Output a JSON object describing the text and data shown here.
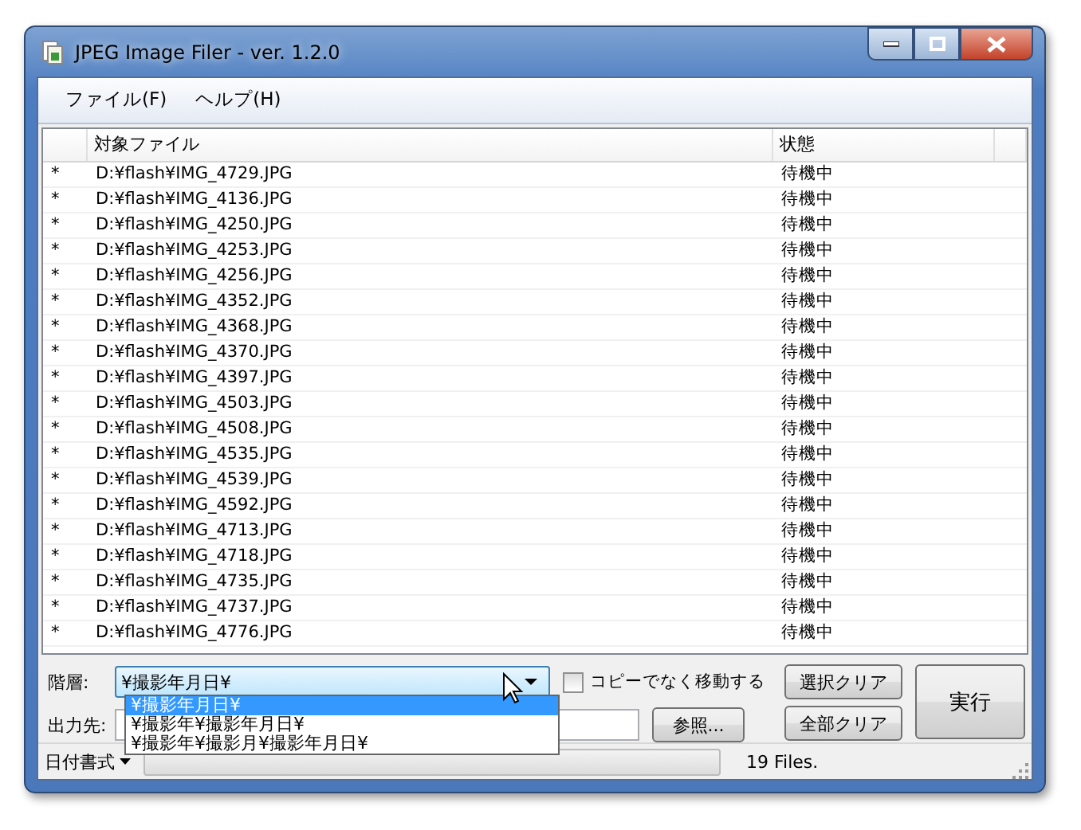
{
  "window": {
    "title": "JPEG Image Filer - ver. 1.2.0"
  },
  "menu": [
    "ファイル(F)",
    "ヘルプ(H)"
  ],
  "table": {
    "columns": [
      "対象ファイル",
      "状態"
    ],
    "rows": [
      {
        "mark": "*",
        "file": "D:¥flash¥IMG_4729.JPG",
        "status": "待機中"
      },
      {
        "mark": "*",
        "file": "D:¥flash¥IMG_4136.JPG",
        "status": "待機中"
      },
      {
        "mark": "*",
        "file": "D:¥flash¥IMG_4250.JPG",
        "status": "待機中"
      },
      {
        "mark": "*",
        "file": "D:¥flash¥IMG_4253.JPG",
        "status": "待機中"
      },
      {
        "mark": "*",
        "file": "D:¥flash¥IMG_4256.JPG",
        "status": "待機中"
      },
      {
        "mark": "*",
        "file": "D:¥flash¥IMG_4352.JPG",
        "status": "待機中"
      },
      {
        "mark": "*",
        "file": "D:¥flash¥IMG_4368.JPG",
        "status": "待機中"
      },
      {
        "mark": "*",
        "file": "D:¥flash¥IMG_4370.JPG",
        "status": "待機中"
      },
      {
        "mark": "*",
        "file": "D:¥flash¥IMG_4397.JPG",
        "status": "待機中"
      },
      {
        "mark": "*",
        "file": "D:¥flash¥IMG_4503.JPG",
        "status": "待機中"
      },
      {
        "mark": "*",
        "file": "D:¥flash¥IMG_4508.JPG",
        "status": "待機中"
      },
      {
        "mark": "*",
        "file": "D:¥flash¥IMG_4535.JPG",
        "status": "待機中"
      },
      {
        "mark": "*",
        "file": "D:¥flash¥IMG_4539.JPG",
        "status": "待機中"
      },
      {
        "mark": "*",
        "file": "D:¥flash¥IMG_4592.JPG",
        "status": "待機中"
      },
      {
        "mark": "*",
        "file": "D:¥flash¥IMG_4713.JPG",
        "status": "待機中"
      },
      {
        "mark": "*",
        "file": "D:¥flash¥IMG_4718.JPG",
        "status": "待機中"
      },
      {
        "mark": "*",
        "file": "D:¥flash¥IMG_4735.JPG",
        "status": "待機中"
      },
      {
        "mark": "*",
        "file": "D:¥flash¥IMG_4737.JPG",
        "status": "待機中"
      },
      {
        "mark": "*",
        "file": "D:¥flash¥IMG_4776.JPG",
        "status": "待機中"
      }
    ]
  },
  "hierarchy": {
    "label": "階層:",
    "value": "¥撮影年月日¥",
    "options": [
      {
        "label": "¥撮影年月日¥",
        "selected": true
      },
      {
        "label": "¥撮影年¥撮影年月日¥",
        "selected": false
      },
      {
        "label": "¥撮影年¥撮影月¥撮影年月日¥",
        "selected": false
      }
    ]
  },
  "move_checkbox": {
    "label": "コピーでなく移動する",
    "checked": false
  },
  "output": {
    "label": "出力先:",
    "browse_button": "参照..."
  },
  "buttons": {
    "clear_selected": "選択クリア",
    "clear_all": "全部クリア",
    "run": "実行"
  },
  "status_bar": {
    "date_format": "日付書式",
    "progress": {
      "level": 0
    },
    "count": "19 Files."
  }
}
